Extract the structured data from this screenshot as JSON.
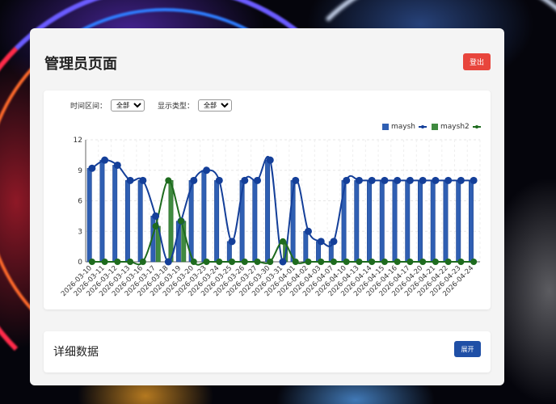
{
  "header": {
    "title": "管理员页面",
    "logout_label": "登出"
  },
  "filters": {
    "time_range_label": "时间区间：",
    "time_range_value": "全部",
    "display_type_label": "显示类型：",
    "display_type_value": "全部"
  },
  "detail": {
    "title": "详细数据",
    "expand_label": "展开"
  },
  "colors": {
    "bar1": "#2f5fb3",
    "line1": "#143f99",
    "bar2": "#3f8a3f",
    "line2": "#1e6b1e",
    "logout": "#e8453c"
  },
  "chart_data": {
    "type": "bar",
    "categories": [
      "2026-03-10",
      "2026-03-11",
      "2026-03-12",
      "2026-03-13",
      "2026-03-16",
      "2026-03-17",
      "2026-03-18",
      "2026-03-19",
      "2026-03-20",
      "2026-03-23",
      "2026-03-24",
      "2026-03-25",
      "2026-03-26",
      "2026-03-27",
      "2026-03-30",
      "2026-03-31",
      "2026-04-01",
      "2026-04-02",
      "2026-04-03",
      "2026-04-07",
      "2026-04-10",
      "2026-04-13",
      "2026-04-14",
      "2026-04-15",
      "2026-04-16",
      "2026-04-17",
      "2026-04-20",
      "2026-04-21",
      "2026-04-22",
      "2026-04-23",
      "2026-04-24"
    ],
    "series": [
      {
        "name": "maysh",
        "values": [
          9.2,
          10,
          9.5,
          8,
          8,
          4.5,
          0,
          4,
          8,
          9,
          8,
          2,
          8,
          8,
          10,
          0,
          8,
          3,
          2,
          2,
          8,
          8,
          8,
          8,
          8,
          8,
          8,
          8,
          8,
          8,
          8
        ]
      },
      {
        "name": "maysh2",
        "values": [
          0,
          0,
          0,
          0,
          0,
          3.5,
          8,
          4,
          0,
          0,
          0,
          0,
          0,
          0,
          0,
          2,
          0,
          0,
          0,
          0,
          0,
          0,
          0,
          0,
          0,
          0,
          0,
          0,
          0,
          0,
          0
        ]
      }
    ],
    "yticks": [
      0,
      3,
      6,
      9,
      12
    ],
    "ylim": [
      0,
      12
    ],
    "legend_position": "top-right",
    "grid": true
  }
}
